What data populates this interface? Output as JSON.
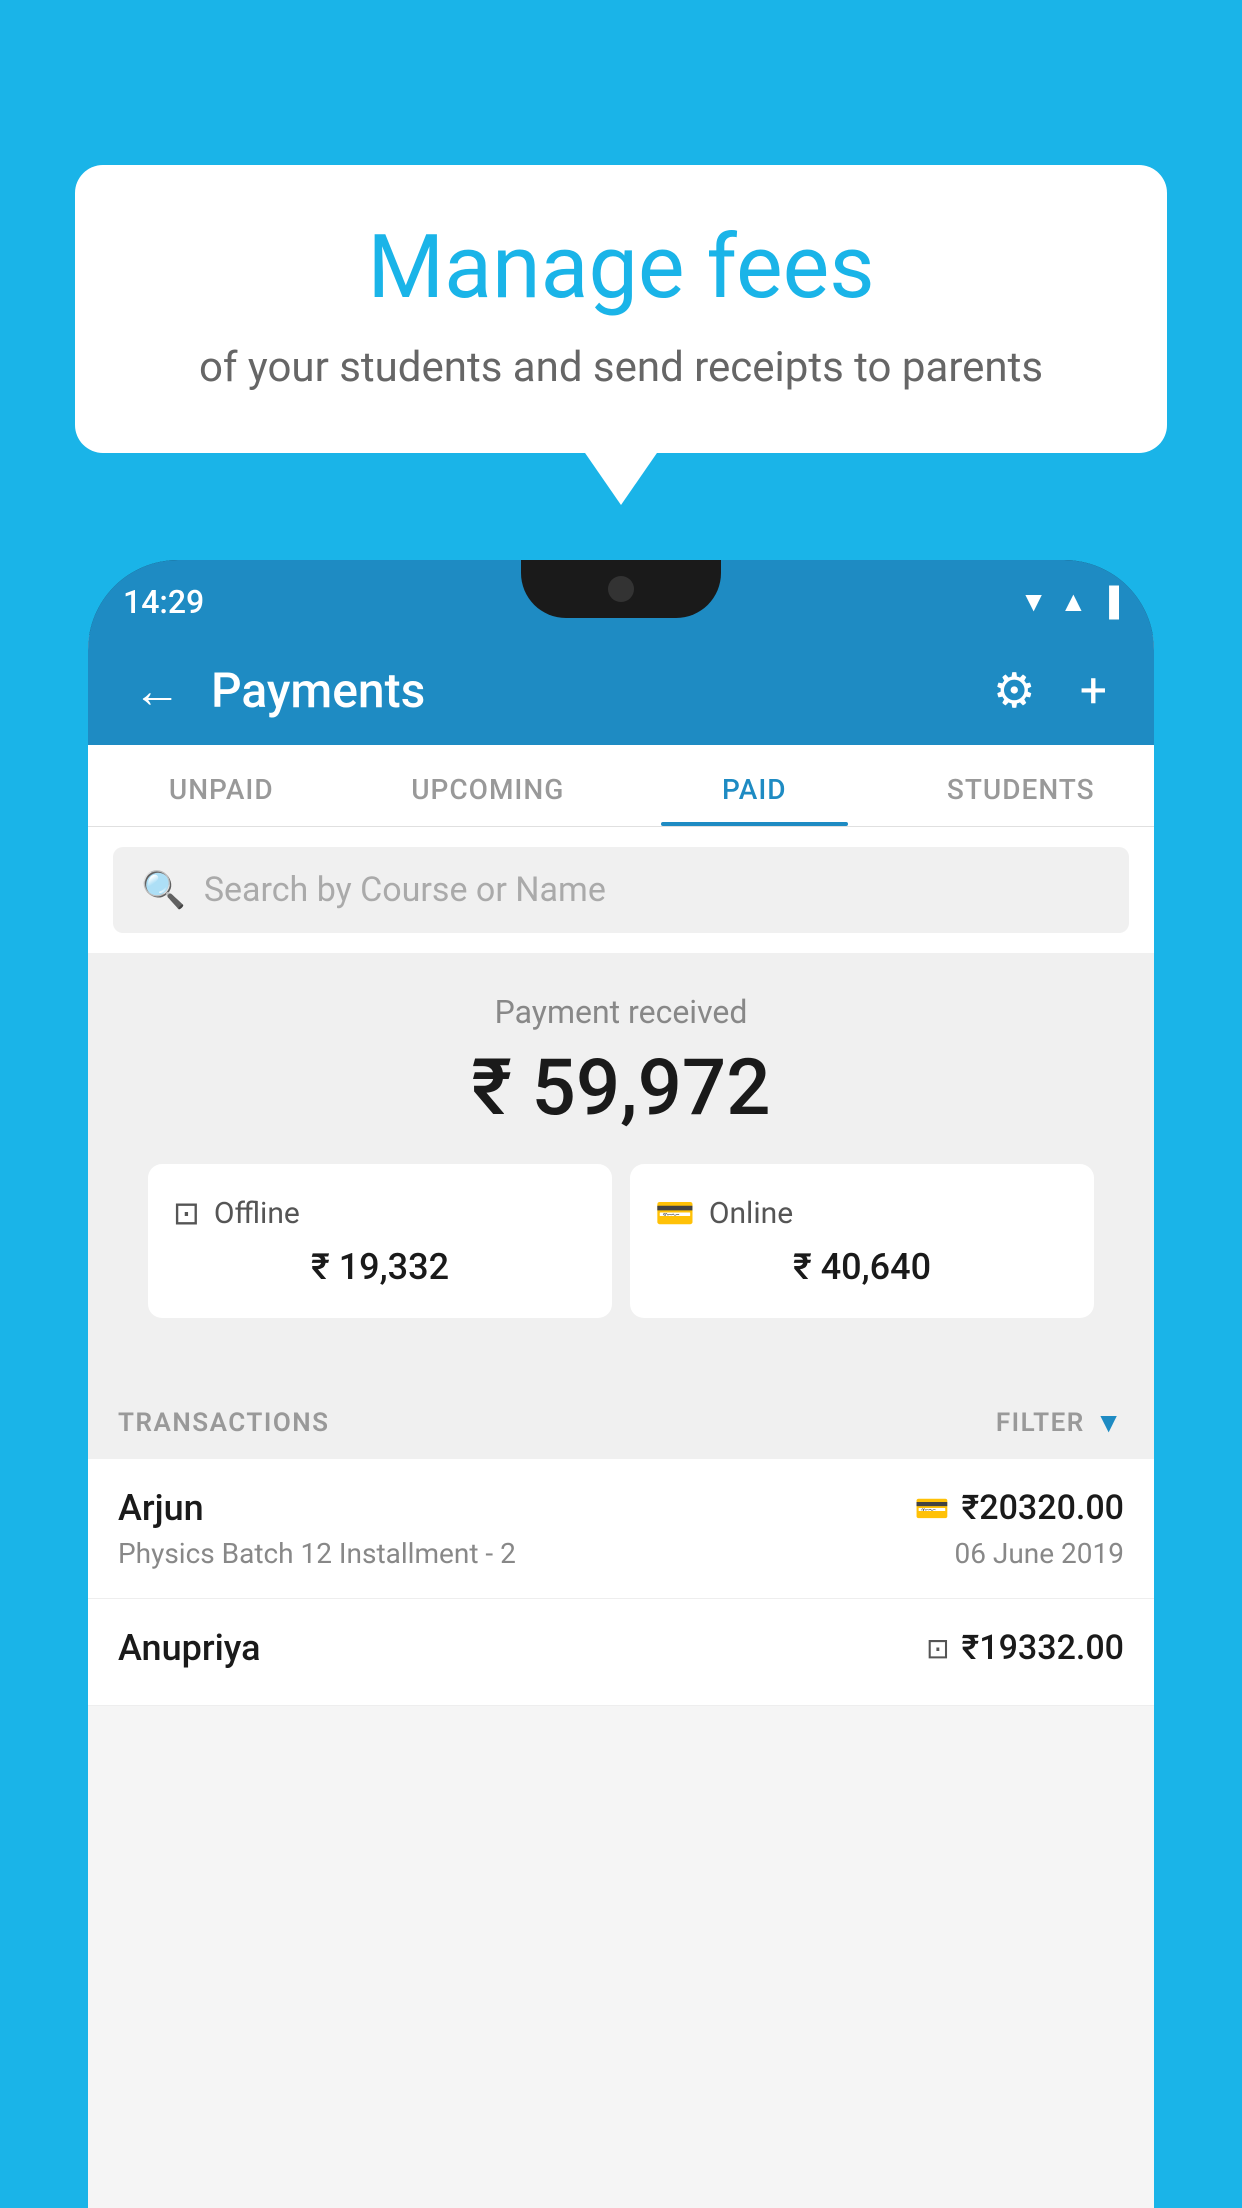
{
  "background_color": "#1ab4e8",
  "bubble": {
    "title": "Manage fees",
    "subtitle": "of your students and send receipts to parents"
  },
  "status_bar": {
    "time": "14:29",
    "wifi": "▲",
    "signal": "▲",
    "battery": "▐"
  },
  "top_bar": {
    "title": "Payments",
    "back_icon": "←",
    "gear_icon": "⚙",
    "plus_icon": "+"
  },
  "tabs": [
    {
      "label": "UNPAID",
      "active": false
    },
    {
      "label": "UPCOMING",
      "active": false
    },
    {
      "label": "PAID",
      "active": true
    },
    {
      "label": "STUDENTS",
      "active": false
    }
  ],
  "search": {
    "placeholder": "Search by Course or Name"
  },
  "summary": {
    "label": "Payment received",
    "total_amount": "₹ 59,972",
    "offline": {
      "icon": "🪙",
      "label": "Offline",
      "amount": "₹ 19,332"
    },
    "online": {
      "icon": "💳",
      "label": "Online",
      "amount": "₹ 40,640"
    }
  },
  "transactions": {
    "header_label": "TRANSACTIONS",
    "filter_label": "FILTER",
    "items": [
      {
        "name": "Arjun",
        "pay_type": "card",
        "amount": "₹20320.00",
        "course": "Physics Batch 12 Installment - 2",
        "date": "06 June 2019"
      },
      {
        "name": "Anupriya",
        "pay_type": "cash",
        "amount": "₹19332.00",
        "course": "",
        "date": ""
      }
    ]
  }
}
